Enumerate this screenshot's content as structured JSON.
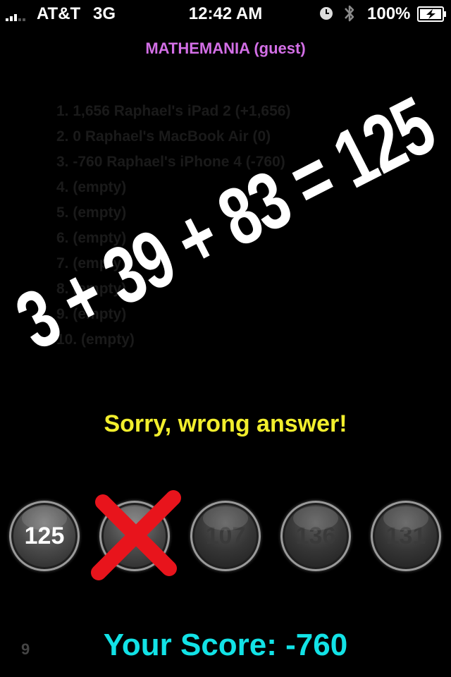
{
  "status_bar": {
    "carrier": "AT&T",
    "network": "3G",
    "time": "12:42 AM",
    "battery": "100%",
    "icons": [
      "signal-icon",
      "clock-icon",
      "bluetooth-icon",
      "battery-charging-icon"
    ]
  },
  "app": {
    "title": "MATHEMANIA (guest)"
  },
  "leaderboard": [
    "1. 1,656 Raphael's iPad 2 (+1,656)",
    "2. 0 Raphael's MacBook Air (0)",
    "3. -760 Raphael's iPhone 4 (-760)",
    "4. (empty)",
    "5. (empty)",
    "6. (empty)",
    "7. (empty)",
    "8. (empty)",
    "9. (empty)",
    "10. (empty)"
  ],
  "equation": "3 + 39 + 83 = 125",
  "feedback": "Sorry, wrong answer!",
  "answers": [
    {
      "label": "125",
      "state": "correct"
    },
    {
      "label": "",
      "state": "wrong-selected"
    },
    {
      "label": "107",
      "state": "dimmed"
    },
    {
      "label": "136",
      "state": "dimmed"
    },
    {
      "label": "131",
      "state": "dimmed"
    }
  ],
  "level": "9",
  "score": "Your Score: -760",
  "colors": {
    "title": "#d36fe6",
    "feedback": "#f2ee2d",
    "score": "#12e2e6",
    "wrong_mark": "#e8141c"
  }
}
